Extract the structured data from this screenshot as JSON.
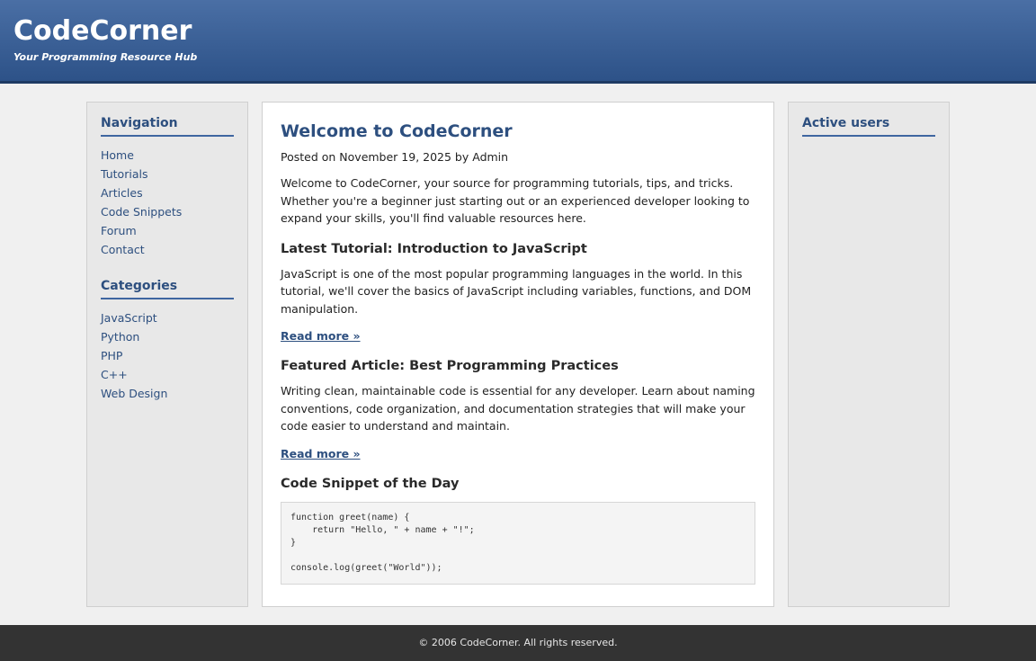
{
  "header": {
    "title": "CodeCorner",
    "tagline": "Your Programming Resource Hub"
  },
  "sidebar_left": {
    "navigation": {
      "heading": "Navigation",
      "items": [
        "Home",
        "Tutorials",
        "Articles",
        "Code Snippets",
        "Forum",
        "Contact"
      ]
    },
    "categories": {
      "heading": "Categories",
      "items": [
        "JavaScript",
        "Python",
        "PHP",
        "C++",
        "Web Design"
      ]
    }
  },
  "sidebar_right": {
    "heading": "Active users"
  },
  "main": {
    "title": "Welcome to CodeCorner",
    "meta": "Posted on November 19, 2025 by Admin",
    "intro": "Welcome to CodeCorner, your source for programming tutorials, tips, and tricks. Whether you're a beginner just starting out or an experienced developer looking to expand your skills, you'll find valuable resources here.",
    "tutorial_heading": "Latest Tutorial: Introduction to JavaScript",
    "tutorial_text": "JavaScript is one of the most popular programming languages in the world. In this tutorial, we'll cover the basics of JavaScript including variables, functions, and DOM manipulation.",
    "tutorial_link": "Read more »",
    "article_heading": "Featured Article: Best Programming Practices",
    "article_text": "Writing clean, maintainable code is essential for any developer. Learn about naming conventions, code organization, and documentation strategies that will make your code easier to understand and maintain.",
    "article_link": "Read more »",
    "snippet_heading": "Code Snippet of the Day",
    "snippet_code": "function greet(name) {\n    return \"Hello, \" + name + \"!\";\n}\n\nconsole.log(greet(\"World\"));"
  },
  "footer": {
    "text": "© 2006 CodeCorner. All rights reserved."
  },
  "colors": {
    "header_gradient_top": "#4a6fa5",
    "header_gradient_bottom": "#2d5288",
    "link": "#2d4f7f",
    "footer_bg": "#333333"
  }
}
